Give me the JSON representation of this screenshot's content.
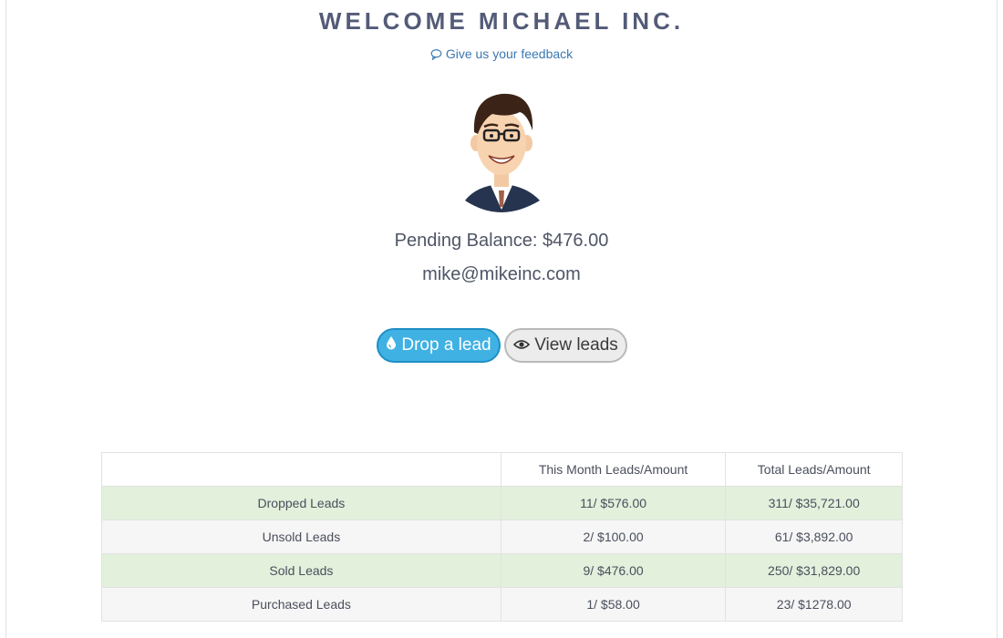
{
  "header": {
    "title": "WELCOME MICHAEL INC.",
    "feedback_link": "Give us your feedback"
  },
  "profile": {
    "balance": "Pending Balance: $476.00",
    "email": "mike@mikeinc.com"
  },
  "actions": {
    "drop_label": "Drop a lead",
    "view_label": "View leads"
  },
  "stats_table": {
    "headers": [
      "",
      "This Month Leads/Amount",
      "Total Leads/Amount"
    ],
    "rows": [
      {
        "label": "Dropped Leads",
        "month": "11/ $576.00",
        "total": "311/ $35,721.00"
      },
      {
        "label": "Unsold Leads",
        "month": "2/ $100.00",
        "total": "61/ $3,892.00"
      },
      {
        "label": "Sold Leads",
        "month": "9/ $476.00",
        "total": "250/ $31,829.00"
      },
      {
        "label": "Purchased Leads",
        "month": "1/ $58.00",
        "total": "23/ $1278.00"
      }
    ]
  },
  "colors": {
    "title": "#535b78",
    "link": "#3b78b3",
    "primary_button": "#3fb1e3",
    "row_highlight": "#e2f0dc"
  }
}
